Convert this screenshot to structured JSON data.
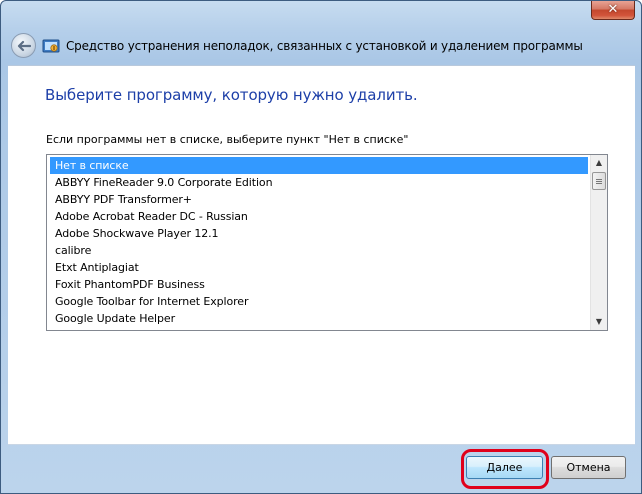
{
  "window": {
    "title": "Средство устранения неполадок, связанных с установкой и удалением программы",
    "close_glyph": "✕"
  },
  "heading": "Выберите программу, которую нужно удалить.",
  "instruction": "Если программы нет в списке, выберите пункт \"Нет в списке\"",
  "program_list": {
    "selected_index": 0,
    "items": [
      "Нет в списке",
      "ABBYY FineReader 9.0 Corporate Edition",
      "ABBYY PDF Transformer+",
      "Adobe Acrobat Reader DC - Russian",
      "Adobe Shockwave Player 12.1",
      "calibre",
      "Etxt Antiplagiat",
      "Foxit PhantomPDF Business",
      "Google Toolbar for Internet Explorer",
      "Google Update Helper"
    ]
  },
  "buttons": {
    "next_label": "Далее",
    "cancel_label": "Отмена"
  },
  "icons": {
    "back": "back-arrow-icon",
    "app": "troubleshooter-icon",
    "scroll_up": "▲",
    "scroll_down": "▼"
  },
  "colors": {
    "heading": "#1d3fa8",
    "selection": "#3399ff",
    "highlight": "#e0001b"
  }
}
